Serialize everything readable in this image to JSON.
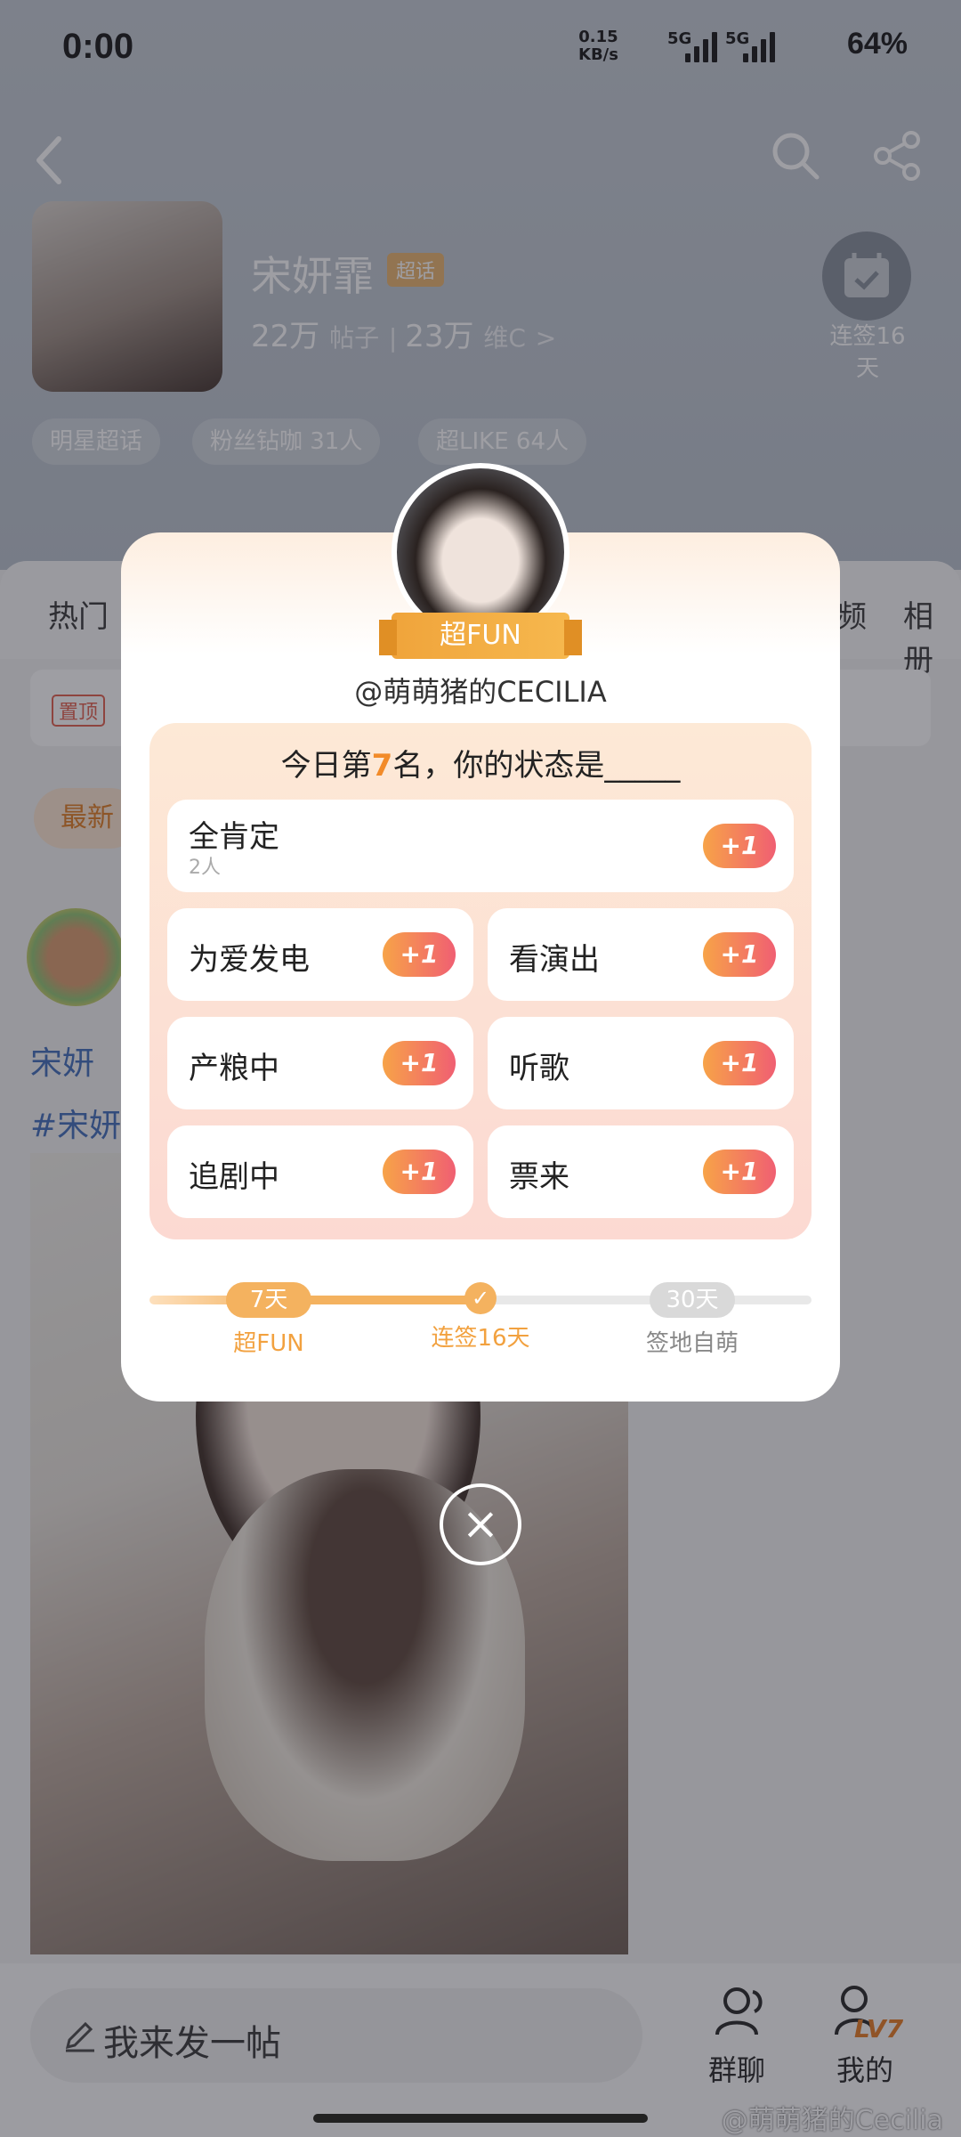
{
  "status_bar": {
    "time": "0:00",
    "net_speed_top": "0.15",
    "net_speed_bottom": "KB/s",
    "sim1": "5G",
    "sim2": "5G",
    "battery": "64%"
  },
  "profile": {
    "name": "宋妍霏",
    "tag": "超话",
    "posts_count": "22万",
    "posts_label": "帖子",
    "fans_count": "23万",
    "fans_label": "维C",
    "checkin_label": "连签16天",
    "chips": [
      "明星超话",
      "粉丝钻咖 31人",
      "超LIKE 64人"
    ]
  },
  "behind": {
    "tabs": [
      "热门",
      "频",
      "相册"
    ],
    "pinned_badge": "置顶",
    "latest_button": "最新",
    "post_text_lines": [
      "宋妍",
      "#宋妍"
    ],
    "compose_placeholder": "我来发一帖",
    "group_chat_label": "群聊",
    "mine_label": "我的",
    "level_badge": "LV7",
    "watermark": "@萌萌猪的Cecilia"
  },
  "modal": {
    "ribbon_label": "超FUN",
    "handle": "@萌萌猪的CECILIA",
    "question_prefix": "今日第",
    "question_rank": "7",
    "question_suffix": "名，你的状态是_____",
    "top_option": {
      "label": "全肯定",
      "count": "2人",
      "action": "+1"
    },
    "options": [
      {
        "label": "为爱发电",
        "action": "+1"
      },
      {
        "label": "看演出",
        "action": "+1"
      },
      {
        "label": "产粮中",
        "action": "+1"
      },
      {
        "label": "听歌",
        "action": "+1"
      },
      {
        "label": "追剧中",
        "action": "+1"
      },
      {
        "label": "票来",
        "action": "+1"
      }
    ],
    "progress": {
      "left_pill": "7天",
      "left_label": "超FUN",
      "mid_label": "连签16天",
      "right_pill": "30天",
      "right_label": "签地自萌"
    },
    "close": "×"
  },
  "colors": {
    "accent_orange": "#f28b29",
    "gradient_start": "#f7a348",
    "gradient_end": "#f05f72"
  }
}
